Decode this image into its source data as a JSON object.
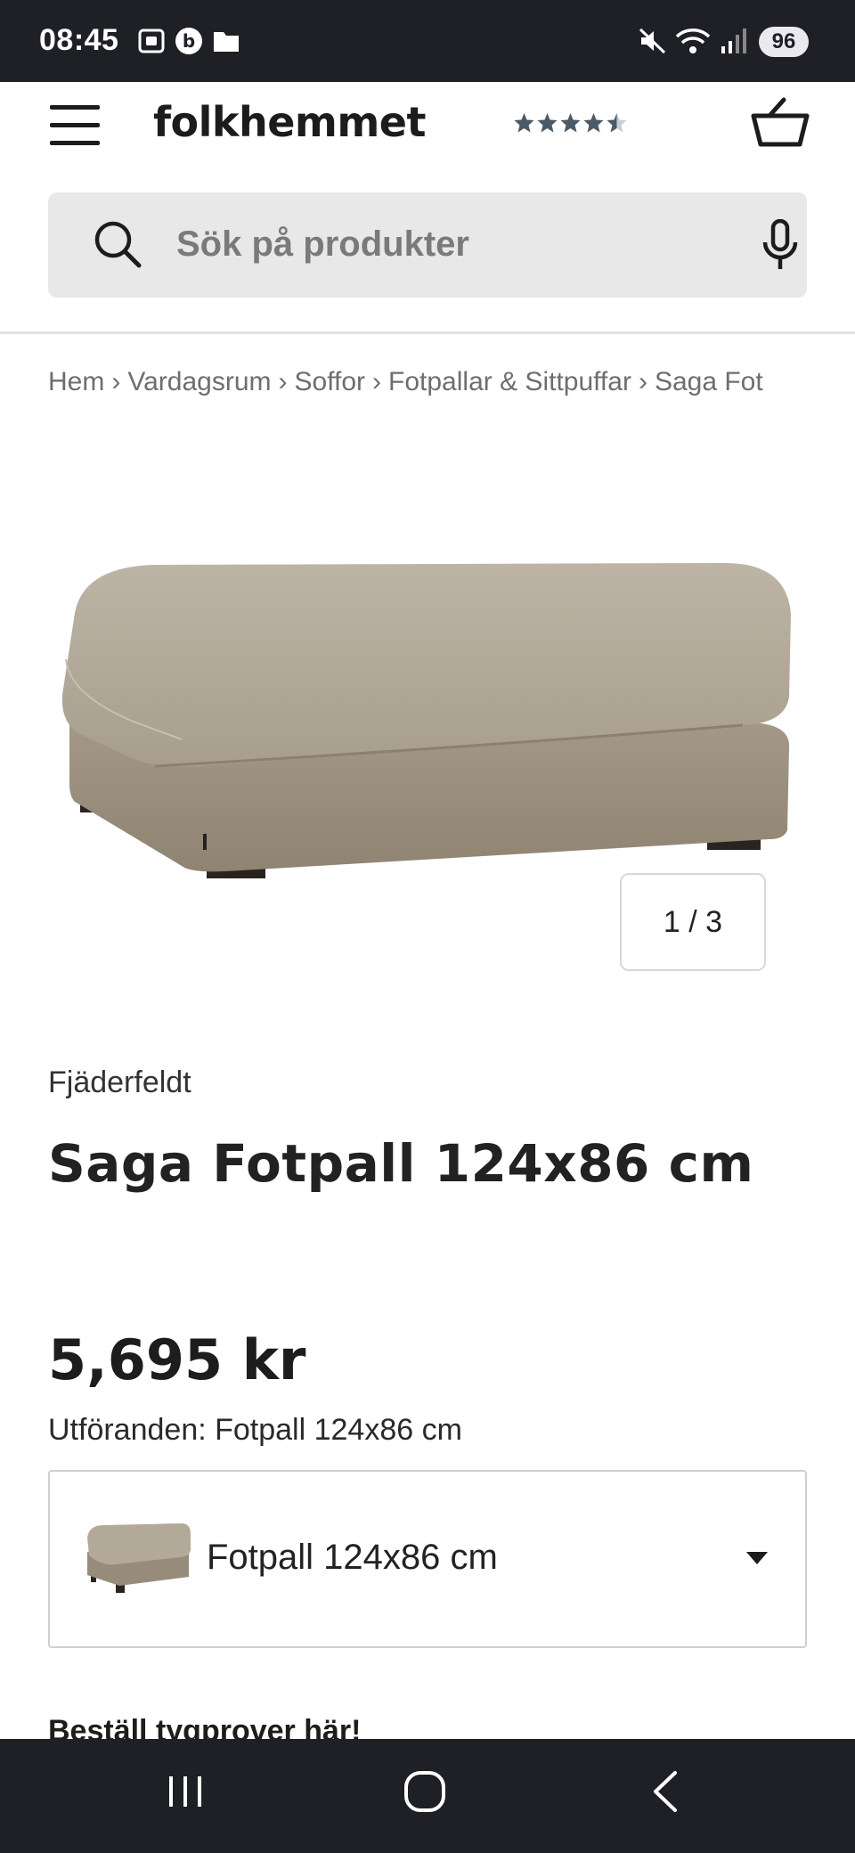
{
  "status_bar": {
    "time": "08:45",
    "battery": "96"
  },
  "header": {
    "logo": "folkhemmet",
    "rating_stars": 4.5,
    "accent_color": "#4a5a66"
  },
  "search": {
    "placeholder": "Sök på produkter"
  },
  "breadcrumb": [
    "Hem",
    "Vardagsrum",
    "Soffor",
    "Fotpallar & Sittpuffar",
    "Saga Fot"
  ],
  "gallery": {
    "counter": "1 / 3"
  },
  "product": {
    "brand": "Fjäderfeldt",
    "title": "Saga Fotpall 124x86 cm",
    "price": "5,695 kr",
    "variant_label": "Utföranden: Fotpall 124x86 cm",
    "selected_variant": "Fotpall 124x86 cm"
  },
  "samples_heading": "Beställ tygprover här!"
}
